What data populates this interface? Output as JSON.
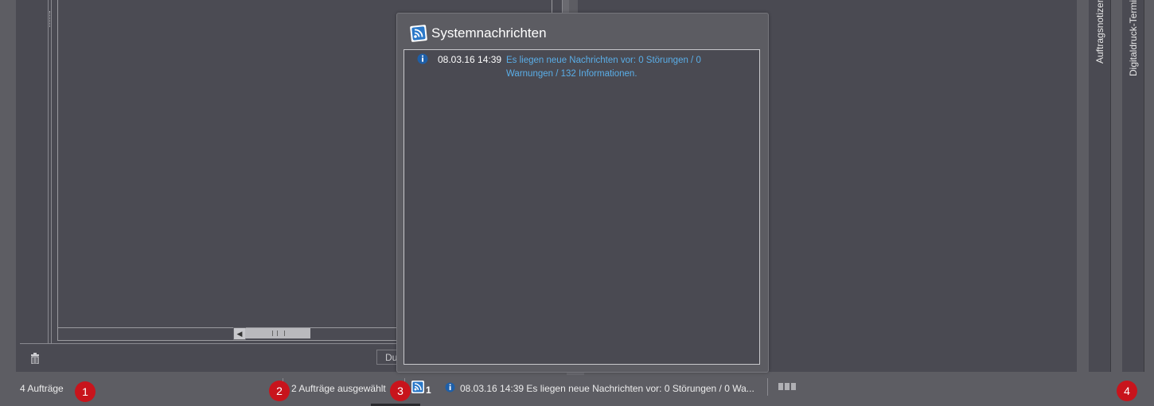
{
  "popup": {
    "title": "Systemnachrichten",
    "messages": [
      {
        "time": "08.03.16 14:39",
        "text": "Es liegen neue Nachrichten vor: 0 Störungen / 0 Warnungen / 132 Informationen."
      }
    ]
  },
  "side_tabs": {
    "tab1": "Auftragsnotizen",
    "tab2": "Digitaldruck-Termine"
  },
  "left_panel": {
    "du_button": "Du"
  },
  "status_bar": {
    "job_count": "4 Aufträge",
    "selected": "2 Aufträge ausgewählt",
    "message_count": "1",
    "message": "08.03.16 14:39  Es liegen neue Nachrichten vor: 0 Störungen / 0 Wa..."
  },
  "callouts": [
    "1",
    "2",
    "3",
    "4"
  ],
  "colors": {
    "callout": "#c8141c",
    "message_link": "#5aaee8",
    "panel": "#4a4a52"
  },
  "icons": {
    "rss": "rss-feed-icon",
    "info": "info-icon",
    "trash": "trash-icon",
    "grid": "grid-icon"
  }
}
